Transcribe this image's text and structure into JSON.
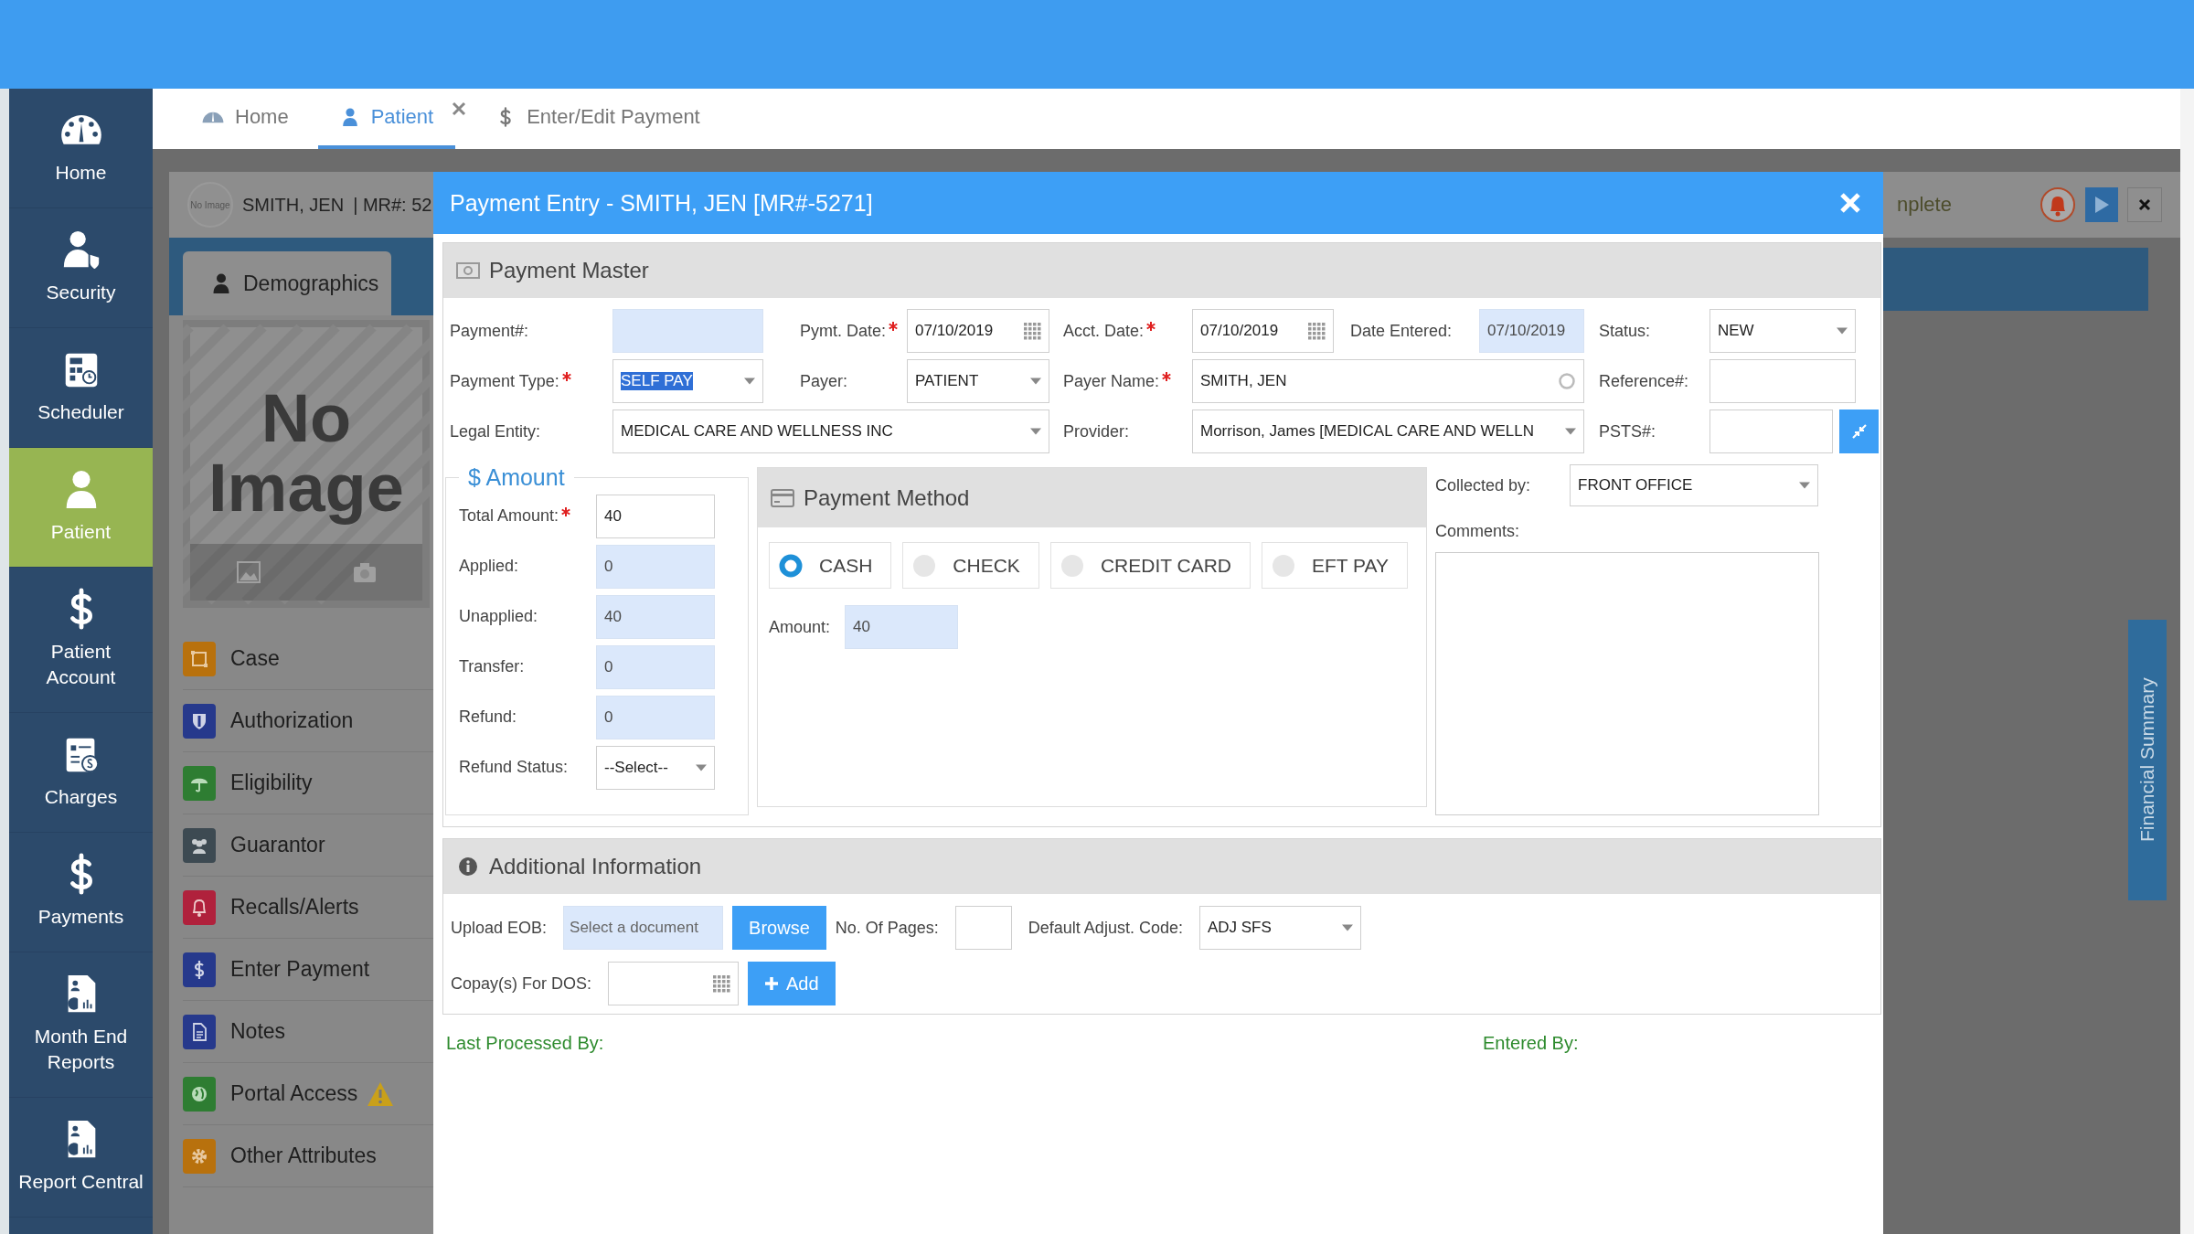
{
  "sidebar": {
    "items": [
      {
        "label": "Home",
        "selected": false
      },
      {
        "label": "Security",
        "selected": false
      },
      {
        "label": "Scheduler",
        "selected": false
      },
      {
        "label": "Patient",
        "selected": true
      },
      {
        "label": "Patient Account",
        "selected": false
      },
      {
        "label": "Charges",
        "selected": false
      },
      {
        "label": "Payments",
        "selected": false
      },
      {
        "label": "Month End Reports",
        "selected": false
      },
      {
        "label": "Report Central",
        "selected": false
      }
    ]
  },
  "tabs": [
    {
      "label": "Home",
      "selected": false,
      "closable": false
    },
    {
      "label": "Patient",
      "selected": true,
      "closable": true
    },
    {
      "label": "Enter/Edit Payment",
      "selected": false,
      "closable": false
    }
  ],
  "patient_panel": {
    "avatar_text": "No Image",
    "name": "SMITH, JEN",
    "mr_number": "| MR#: 52",
    "status_text": "nplete",
    "tab": "Demographics",
    "photo_text": "No Image",
    "menu": [
      {
        "label": "Case",
        "color": "#b8710d",
        "alert": false
      },
      {
        "label": "Authorization",
        "color": "#26398c",
        "alert": false
      },
      {
        "label": "Eligibility",
        "color": "#2e7d32",
        "alert": false
      },
      {
        "label": "Guarantor",
        "color": "#3d4a52",
        "alert": false
      },
      {
        "label": "Recalls/Alerts",
        "color": "#b0213c",
        "alert": false
      },
      {
        "label": "Enter Payment",
        "color": "#26398c",
        "alert": false
      },
      {
        "label": "Notes",
        "color": "#26398c",
        "alert": false
      },
      {
        "label": "Portal Access",
        "color": "#2e7d32",
        "alert": true
      },
      {
        "label": "Other Attributes",
        "color": "#b8710d",
        "alert": false
      }
    ],
    "side_tab": "Financial Summary"
  },
  "dialog": {
    "title": "Payment Entry - SMITH, JEN [MR#-5271]",
    "payment_master": {
      "title": "Payment Master",
      "fields": [
        {
          "label": "Payment#:",
          "required": false,
          "kind": "readonly"
        },
        {
          "label": "Pymt. Date:",
          "required": true,
          "kind": "date",
          "value": "07/10/2019",
          "highlighted": false
        },
        {
          "label": "Acct. Date:",
          "required": true,
          "kind": "date",
          "value": "07/10/2019",
          "highlighted": false
        },
        {
          "label": "Date Entered:",
          "required": false,
          "kind": "readonly",
          "value": "07/10/2019",
          "highlighted": false
        },
        {
          "label": "Status:",
          "required": false,
          "kind": "select",
          "value": "NEW",
          "highlighted": false
        },
        {
          "label": "Payment Type:",
          "required": true,
          "kind": "select",
          "value": "SELF PAY",
          "highlighted": true
        },
        {
          "label": "Payer:",
          "required": false,
          "kind": "select",
          "value": "PATIENT",
          "highlighted": false
        },
        {
          "label": "Payer Name:",
          "required": true,
          "kind": "search",
          "value": "SMITH, JEN",
          "highlighted": false
        },
        {
          "label": "Reference#:",
          "required": false,
          "kind": "text"
        },
        {
          "label": "Legal Entity:",
          "required": false,
          "kind": "select",
          "value": "MEDICAL CARE AND WELLNESS INC",
          "highlighted": false
        },
        {
          "label": "Provider:",
          "required": false,
          "kind": "select",
          "value": "Morrison, James [MEDICAL CARE AND WELLN",
          "highlighted": false
        },
        {
          "label": "PSTS#:",
          "required": false,
          "kind": "text_action"
        }
      ]
    },
    "amount": {
      "title": "$ Amount",
      "fields": [
        {
          "label": "Total Amount:",
          "required": true,
          "kind": "text",
          "value": "40"
        },
        {
          "label": "Applied:",
          "required": false,
          "kind": "readonly",
          "value": "0"
        },
        {
          "label": "Unapplied:",
          "required": false,
          "kind": "readonly",
          "value": "40"
        },
        {
          "label": "Transfer:",
          "required": false,
          "kind": "readonly",
          "value": "0"
        },
        {
          "label": "Refund:",
          "required": false,
          "kind": "readonly",
          "value": "0"
        },
        {
          "label": "Refund Status:",
          "required": false,
          "kind": "select",
          "value": "--Select--"
        }
      ]
    },
    "payment_method": {
      "title": "Payment Method",
      "options": [
        {
          "label": "CASH",
          "selected": true
        },
        {
          "label": "CHECK",
          "selected": false
        },
        {
          "label": "CREDIT CARD",
          "selected": false
        },
        {
          "label": "EFT PAY",
          "selected": false
        }
      ],
      "amount_label": "Amount:",
      "amount_value": "40"
    },
    "collected_by": {
      "label": "Collected by:",
      "value": "FRONT OFFICE"
    },
    "comments": {
      "label": "Comments:"
    },
    "additional_info": {
      "title": "Additional Information",
      "upload_label": "Upload EOB:",
      "upload_placeholder": "Select a document",
      "browse_button": "Browse",
      "pages_label": "No. Of Pages:",
      "adjust_label": "Default Adjust. Code:",
      "adjust_value": "ADJ SFS",
      "copay_label": "Copay(s) For DOS:",
      "add_button": "Add"
    },
    "footer": {
      "last_processed": "Last Processed By:",
      "entered_by": "Entered By:"
    }
  }
}
